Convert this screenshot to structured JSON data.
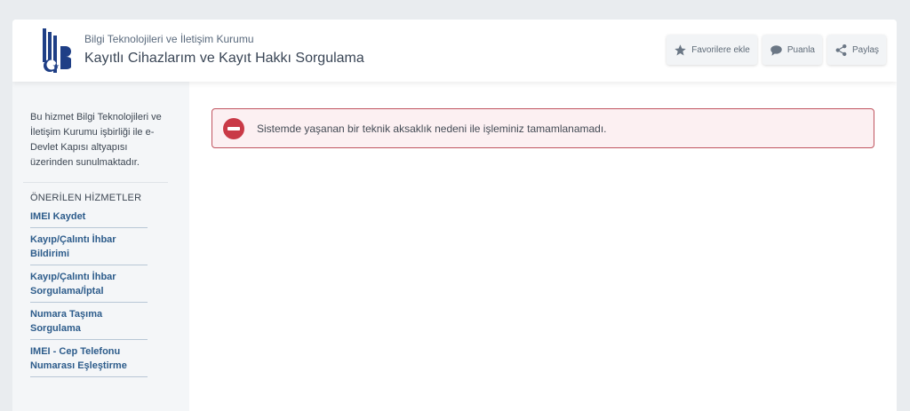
{
  "header": {
    "org_name": "Bilgi Teknolojileri ve İletişim Kurumu",
    "service_title": "Kayıtlı Cihazlarım ve Kayıt Hakkı Sorgulama",
    "actions": {
      "favorites": "Favorilere ekle",
      "rate": "Puanla",
      "share": "Paylaş"
    }
  },
  "sidebar": {
    "note": "Bu hizmet Bilgi Teknolojileri ve İletişim Kurumu işbirliği ile e-Devlet Kapısı altyapısı üzerinden sunulmaktadır.",
    "heading": "ÖNERİLEN HİZMETLER",
    "links": [
      "IMEI Kaydet",
      "Kayıp/Çalıntı İhbar Bildirimi",
      "Kayıp/Çalıntı İhbar Sorgulama/İptal",
      "Numara Taşıma Sorgulama",
      "IMEI - Cep Telefonu Numarası Eşleştirme"
    ]
  },
  "alert": {
    "message": "Sistemde yaşanan bir teknik aksaklık nedeni ile işleminiz tamamlanamadı."
  },
  "colors": {
    "accent": "#1f3f86",
    "link": "#2d5c8b",
    "error": "#c93a47",
    "error_bg": "#fcf0f2"
  }
}
